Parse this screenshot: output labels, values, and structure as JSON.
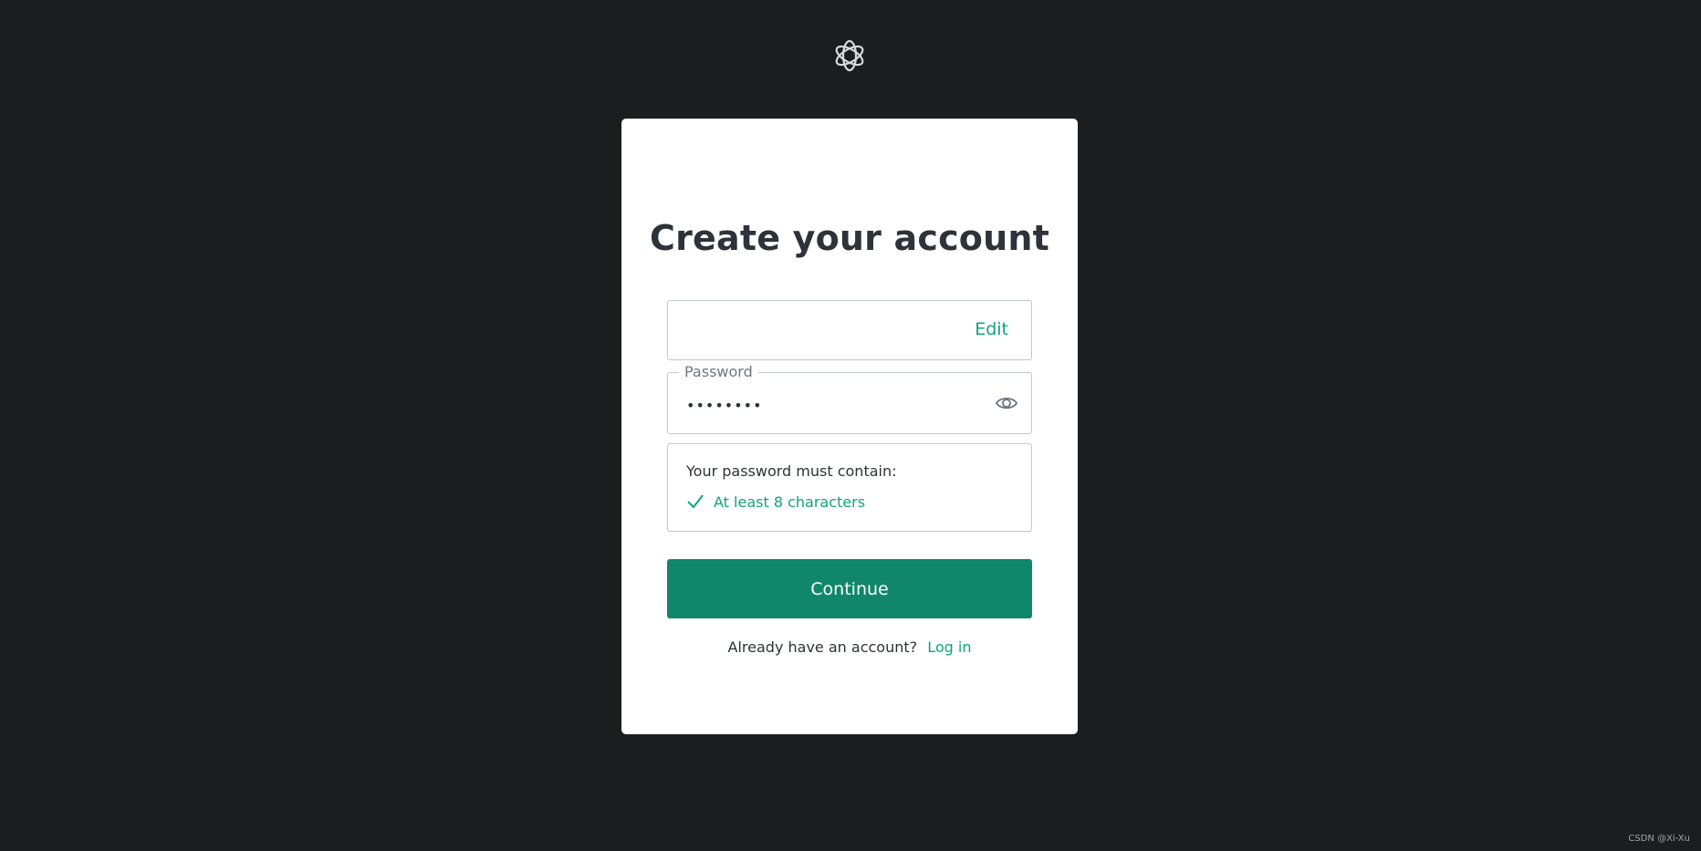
{
  "logo": {
    "icon": "openai-logo-icon"
  },
  "card": {
    "title": "Create your account",
    "email_field": {
      "value": "",
      "edit_label": "Edit"
    },
    "password_field": {
      "label": "Password",
      "value": "••••••••",
      "toggle_icon": "eye-icon"
    },
    "requirements": {
      "title": "Your password must contain:",
      "items": [
        {
          "label": "At least 8 characters",
          "icon": "check-icon",
          "met": true
        }
      ]
    },
    "continue_label": "Continue",
    "login_prompt": "Already have an account?",
    "login_link": "Log in"
  },
  "watermark": "CSDN @Xi-Xu",
  "colors": {
    "background": "#1c1d1f",
    "accent": "#10a37f",
    "button": "#10876a",
    "text": "#2d333a"
  }
}
